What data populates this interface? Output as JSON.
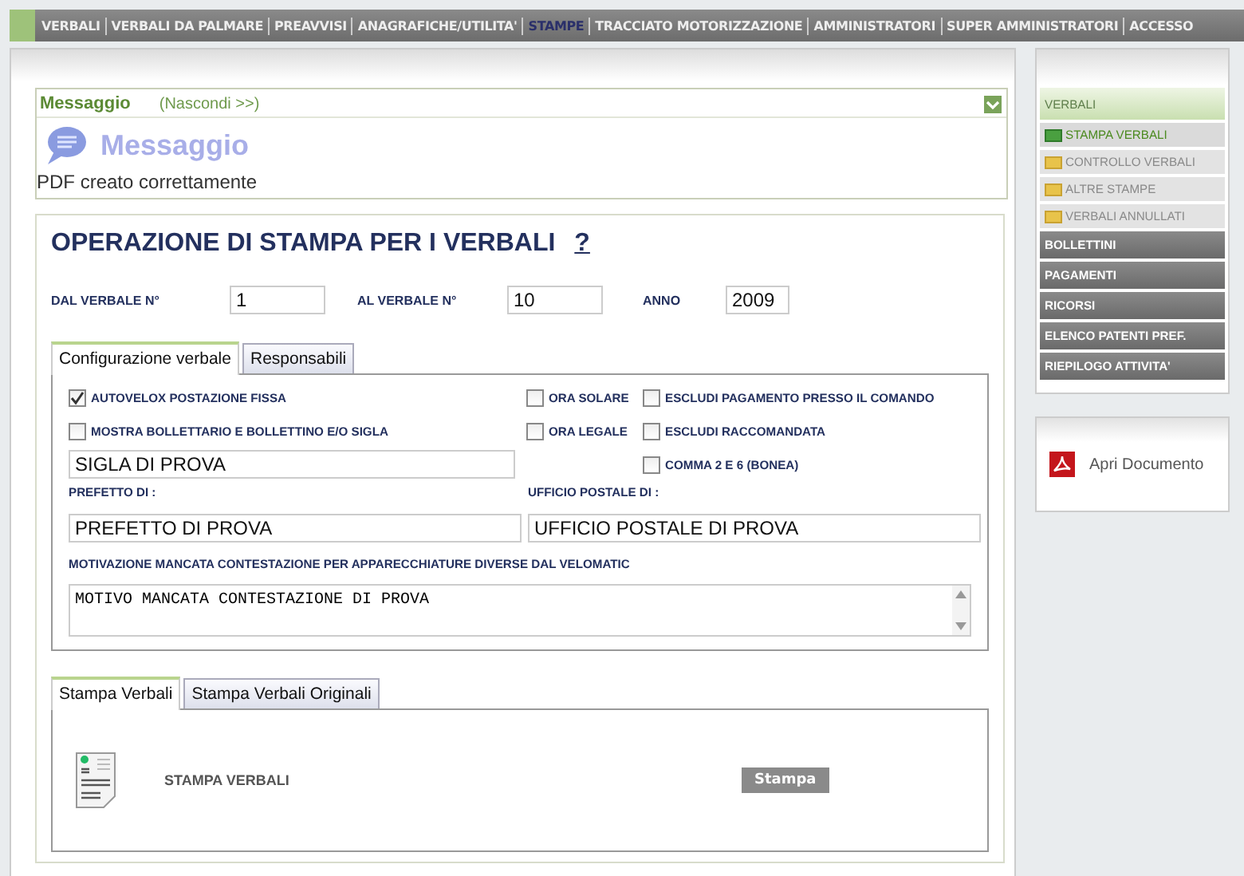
{
  "nav": [
    {
      "label": "VERBALI",
      "selected": false
    },
    {
      "label": "VERBALI DA PALMARE",
      "selected": false
    },
    {
      "label": "PREAVVISI",
      "selected": false
    },
    {
      "label": "ANAGRAFICHE/UTILITA'",
      "selected": false
    },
    {
      "label": "STAMPE",
      "selected": true
    },
    {
      "label": "TRACCIATO MOTORIZZAZIONE",
      "selected": false
    },
    {
      "label": "AMMINISTRATORI",
      "selected": false
    },
    {
      "label": "SUPER AMMINISTRATORI",
      "selected": false
    },
    {
      "label": "ACCESSO",
      "selected": false
    }
  ],
  "message": {
    "header": "Messaggio",
    "toggle": "(Nascondi >>)",
    "title": "Messaggio",
    "text": "PDF creato correttamente"
  },
  "form": {
    "title": "OPERAZIONE DI STAMPA PER I VERBALI",
    "help": "?",
    "range": [
      {
        "label": "DAL VERBALE N°",
        "value": "1"
      },
      {
        "label": "AL VERBALE N°",
        "value": "10"
      },
      {
        "label": "ANNO",
        "value": "2009"
      }
    ],
    "tabs": [
      {
        "label": "Configurazione verbale",
        "selected": true
      },
      {
        "label": "Responsabili",
        "selected": false
      }
    ],
    "options_left": [
      {
        "label": "AUTOVELOX POSTAZIONE FISSA",
        "checked": true
      },
      {
        "label": "MOSTRA BOLLETTARIO E BOLLETTINO E/O SIGLA",
        "checked": false
      }
    ],
    "options_mid": [
      {
        "label": "ORA SOLARE",
        "checked": false
      },
      {
        "label": "ORA LEGALE",
        "checked": false
      }
    ],
    "options_right": [
      {
        "label": "ESCLUDI PAGAMENTO PRESSO IL COMANDO",
        "checked": false
      },
      {
        "label": "ESCLUDI RACCOMANDATA",
        "checked": false
      },
      {
        "label": "COMMA 2 E 6 (BONEA)",
        "checked": false
      }
    ],
    "sigla": "SIGLA DI PROVA",
    "prefetto": {
      "label": "PREFETTO DI :",
      "value": "PREFETTO DI PROVA"
    },
    "ufficio": {
      "label": "UFFICIO POSTALE DI :",
      "value": "UFFICIO POSTALE DI PROVA"
    },
    "motivazione": {
      "label": "MOTIVAZIONE MANCATA CONTESTAZIONE PER APPARECCHIATURE DIVERSE DAL VELOMATIC",
      "value": "MOTIVO MANCATA CONTESTAZIONE DI PROVA"
    }
  },
  "print": {
    "tabs": [
      {
        "label": "Stampa Verbali",
        "selected": true
      },
      {
        "label": "Stampa Verbali Originali",
        "selected": false
      }
    ],
    "label": "STAMPA VERBALI",
    "button": "Stampa"
  },
  "sidebar": {
    "items": [
      {
        "label": "VERBALI",
        "kind": "section"
      },
      {
        "label": "STAMPA VERBALI",
        "kind": "sub",
        "selected": true
      },
      {
        "label": "CONTROLLO VERBALI",
        "kind": "sub",
        "selected": false
      },
      {
        "label": "ALTRE STAMPE",
        "kind": "sub",
        "selected": false
      },
      {
        "label": "VERBALI ANNULLATI",
        "kind": "sub",
        "selected": false
      },
      {
        "label": "BOLLETTINI",
        "kind": "menu"
      },
      {
        "label": "PAGAMENTI",
        "kind": "menu"
      },
      {
        "label": "RICORSI",
        "kind": "menu"
      },
      {
        "label": "ELENCO PATENTI PREF.",
        "kind": "menu"
      },
      {
        "label": "RIEPILOGO ATTIVITA'",
        "kind": "menu"
      }
    ]
  },
  "document": {
    "label": "Apri Documento"
  }
}
